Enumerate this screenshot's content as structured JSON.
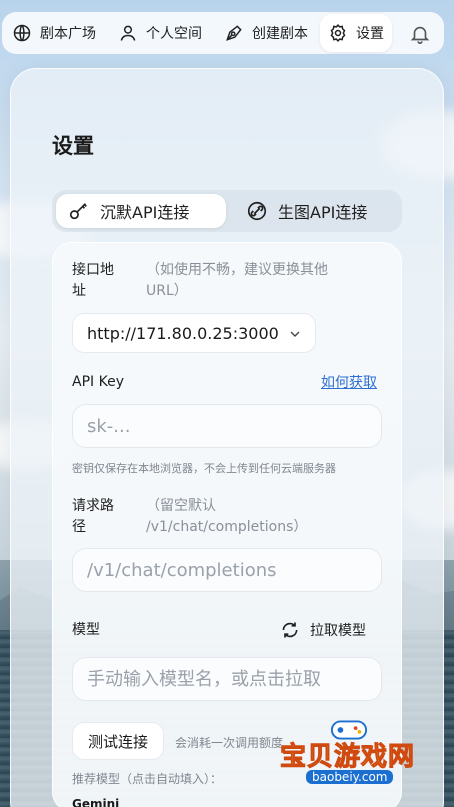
{
  "nav": {
    "items": [
      {
        "label": "剧本广场",
        "icon": "globe-icon"
      },
      {
        "label": "个人空间",
        "icon": "user-icon"
      },
      {
        "label": "创建剧本",
        "icon": "pen-tool-icon"
      },
      {
        "label": "设置",
        "icon": "gear-icon",
        "active": true
      }
    ],
    "bell_icon": "bell-icon"
  },
  "settings": {
    "title": "设置",
    "tabs": [
      {
        "label": "沉默API连接",
        "icon": "key-icon",
        "active": true
      },
      {
        "label": "生图API连接",
        "icon": "image-link-icon",
        "active": false
      }
    ],
    "endpoint": {
      "label_line1": "接口地",
      "label_line2": "址",
      "hint_line1": "（如使用不畅，建议更换其他",
      "hint_line2": "URL）",
      "selected": "http://171.80.0.25:3000"
    },
    "api_key": {
      "label": "API Key",
      "how_link": "如何获取",
      "placeholder": "sk-...",
      "note": "密钥仅保存在本地浏览器，不会上传到任何云端服务器"
    },
    "path": {
      "label_line1": "请求路",
      "label_line2": "径",
      "hint_line1": "（留空默认",
      "hint_line2": "/v1/chat/completions）",
      "placeholder": "/v1/chat/completions"
    },
    "model": {
      "label": "模型",
      "pull_label": "拉取模型",
      "placeholder": "手动输入模型名，或点击拉取"
    },
    "test": {
      "button": "测试连接",
      "note": "会消耗一次调用额度"
    },
    "recommend": {
      "label": "推荐模型（点击自动填入）：",
      "first": "Gemini"
    }
  },
  "watermark": {
    "text": "宝贝游戏网",
    "sub": "baobeiy.com"
  },
  "colors": {
    "link": "#2d6fd2",
    "watermark_yellow": "#ffd04a",
    "watermark_blue": "#1b6fd0"
  }
}
